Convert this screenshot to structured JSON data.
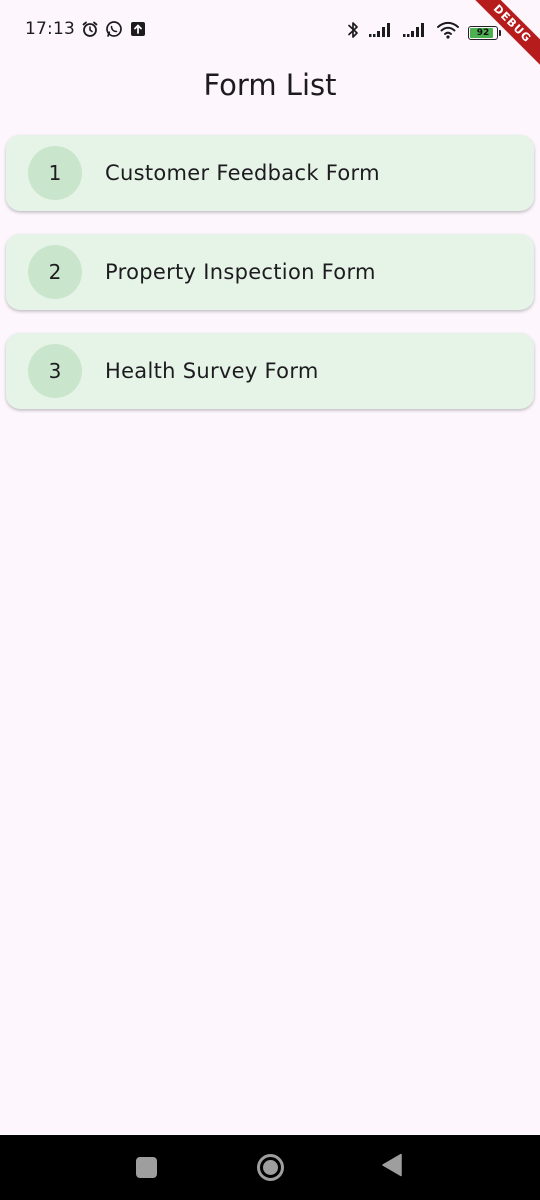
{
  "status_bar": {
    "time": "17:13",
    "left_icons": [
      "alarm-icon",
      "whatsapp-icon",
      "upload-icon"
    ],
    "right_icons": [
      "bluetooth-icon",
      "signal-icon",
      "signal-icon",
      "wifi-icon"
    ],
    "battery_level": "92",
    "battery_fraction": 0.92,
    "battery_color": "#4caf50"
  },
  "debug_banner": {
    "label": "DEBUG",
    "color": "#b71c1c"
  },
  "app_bar": {
    "title": "Form List"
  },
  "forms": [
    {
      "number": "1",
      "title": "Customer Feedback Form"
    },
    {
      "number": "2",
      "title": "Property Inspection Form"
    },
    {
      "number": "3",
      "title": "Health Survey Form"
    }
  ],
  "colors": {
    "background": "#fdf7fd",
    "card": "#e6f4e7",
    "avatar": "#c9e6cc",
    "nav_bar": "#000000",
    "nav_icon": "#9e9e9e"
  },
  "nav_bar": {
    "buttons": [
      "recents-icon",
      "home-icon",
      "back-icon"
    ]
  }
}
